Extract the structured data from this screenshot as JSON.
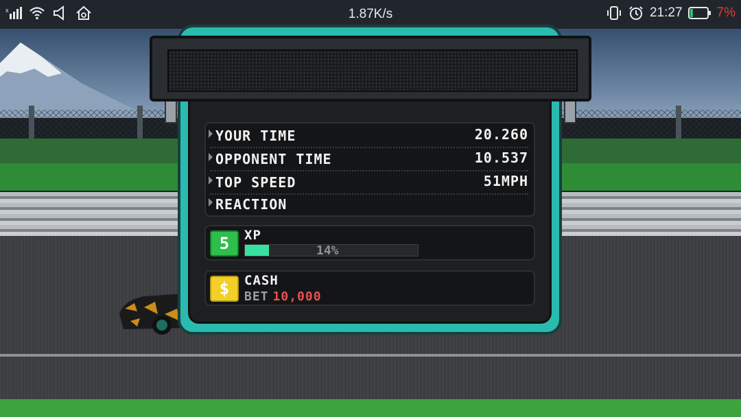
{
  "status_bar": {
    "network_speed": "1.87K/s",
    "time": "21:27",
    "battery_percent": "7%",
    "left_icons": [
      "signal-icon",
      "wifi-icon",
      "volume-icon",
      "home-icon"
    ],
    "right_icons": [
      "vibrate-icon",
      "alarm-icon",
      "battery-icon"
    ],
    "battery_level": 0.07
  },
  "results": {
    "rows": [
      {
        "label": "YOUR TIME",
        "value": "20.260"
      },
      {
        "label": "OPPONENT TIME",
        "value": "10.537"
      },
      {
        "label": "TOP SPEED",
        "value": "51MPH"
      },
      {
        "label": "REACTION",
        "value": ""
      }
    ]
  },
  "xp": {
    "level": "5",
    "label": "XP",
    "percent_text": "14%",
    "progress": 0.14,
    "color": "#37e2a0"
  },
  "cash": {
    "icon_symbol": "$",
    "label": "CASH",
    "bet_label": "BET",
    "bet_value": "10,000",
    "bet_color": "#e8514f"
  },
  "colors": {
    "frame_accent": "#2bbab0",
    "xp_badge": "#2dbf4a",
    "cash_badge": "#f2d027"
  }
}
